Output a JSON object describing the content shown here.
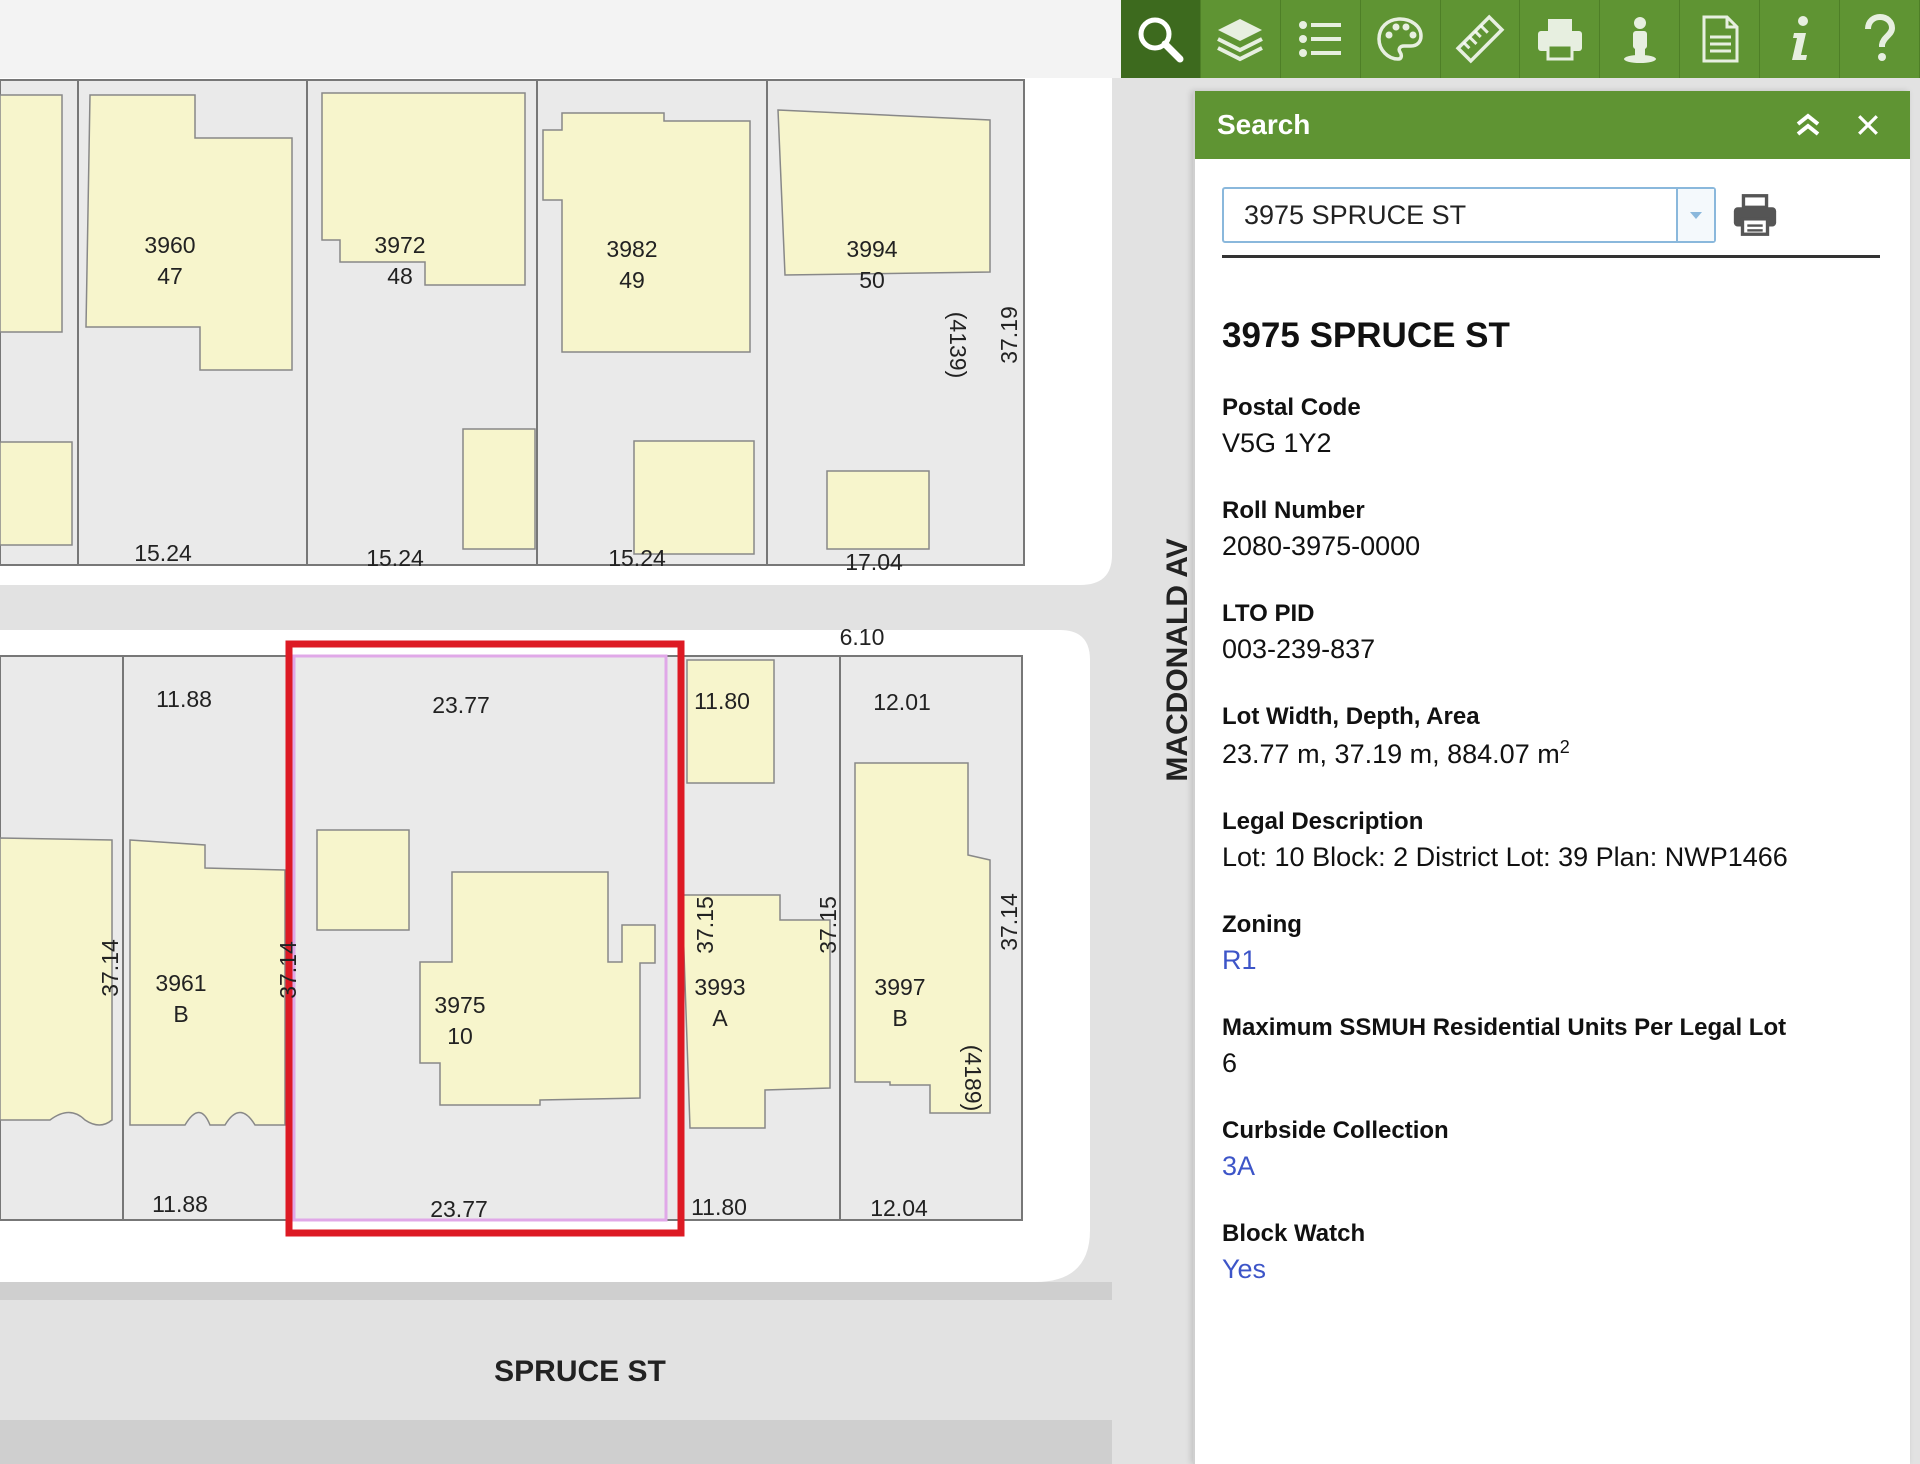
{
  "map": {
    "streets": {
      "vertical": "MACDONALD AV",
      "horizontal": "SPRUCE ST"
    },
    "lane_width": "6.10",
    "north_block": [
      {
        "address": "3960",
        "lot": "47",
        "frontage": "15.24"
      },
      {
        "address": "3972",
        "lot": "48",
        "frontage": "15.24"
      },
      {
        "address": "3982",
        "lot": "49",
        "frontage": "15.24"
      },
      {
        "address": "3994",
        "lot": "50",
        "frontage": "17.04",
        "side_depth": "37.19",
        "secondary_address": "(4139)"
      }
    ],
    "south_block": [
      {
        "address": "3961",
        "lot": "B",
        "top": "11.88",
        "bottom": "11.88",
        "left_depth": "37.14",
        "right_depth": "37.14"
      },
      {
        "address": "3975",
        "lot": "10",
        "top": "23.77",
        "bottom": "23.77"
      },
      {
        "address": "3993",
        "lot": "A",
        "top": "11.80",
        "bottom": "11.80",
        "left_depth": "37.15",
        "right_depth": "37.15"
      },
      {
        "address": "3997",
        "lot": "B",
        "top": "12.01",
        "bottom": "12.04",
        "right_depth": "37.14",
        "secondary_address": "(4189)"
      }
    ]
  },
  "toolbar": {
    "tools": [
      "search-icon",
      "layers-icon",
      "legend-list-icon",
      "palette-icon",
      "ruler-icon",
      "printer-icon",
      "street-view-person-icon",
      "document-icon",
      "info-icon",
      "help-icon"
    ],
    "active": "search-icon"
  },
  "panel": {
    "title": "Search",
    "search_value": "3975 SPRUCE ST",
    "address": "3975 SPRUCE ST",
    "postal_code": {
      "label": "Postal Code",
      "value": "V5G 1Y2"
    },
    "roll_number": {
      "label": "Roll Number",
      "value": "2080-3975-0000"
    },
    "lto_pid": {
      "label": "LTO PID",
      "value": "003-239-837"
    },
    "lot_size": {
      "label": "Lot Width, Depth, Area",
      "value": "23.77 m, 37.19 m, 884.07 m",
      "unit_sup": "2"
    },
    "legal": {
      "label": "Legal Description",
      "value": "Lot: 10 Block: 2 District Lot: 39 Plan: NWP1466"
    },
    "zoning": {
      "label": "Zoning",
      "value": "R1"
    },
    "ssmuh": {
      "label": "Maximum SSMUH Residential Units Per Legal Lot",
      "value": "6"
    },
    "curbside": {
      "label": "Curbside Collection",
      "value": "3A"
    },
    "block_watch": {
      "label": "Block Watch",
      "value": "Yes"
    }
  },
  "colors": {
    "toolbar_green": "#5f9433",
    "highlight_red": "#dd1a24",
    "building_fill": "#f7f5cc",
    "parcel_fill": "#eaeaea",
    "road_fill": "#e2e2e2",
    "link_blue": "#3d55c8"
  }
}
